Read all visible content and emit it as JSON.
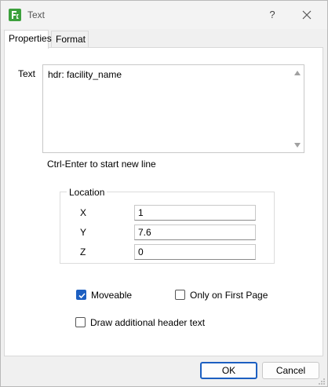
{
  "window": {
    "title": "Text",
    "help_label": "?",
    "icon": "app-logo-icon",
    "close_icon": "close-icon"
  },
  "tabs": [
    {
      "label": "Properties",
      "active": true
    },
    {
      "label": "Format",
      "active": false
    }
  ],
  "text_field": {
    "label": "Text",
    "value": "hdr: facility_name",
    "hint": "Ctrl-Enter to start new line"
  },
  "location": {
    "legend": "Location",
    "fields": [
      {
        "label": "X",
        "value": "1"
      },
      {
        "label": "Y",
        "value": "7.6"
      },
      {
        "label": "Z",
        "value": "0"
      }
    ]
  },
  "options": {
    "moveable": {
      "label": "Moveable",
      "checked": true
    },
    "only_first_page": {
      "label": "Only on First Page",
      "checked": false
    },
    "draw_header": {
      "label": "Draw additional header text",
      "checked": false
    }
  },
  "buttons": {
    "ok": "OK",
    "cancel": "Cancel"
  },
  "colors": {
    "accent": "#1c5fc1",
    "app_icon": "#3ca03c"
  }
}
